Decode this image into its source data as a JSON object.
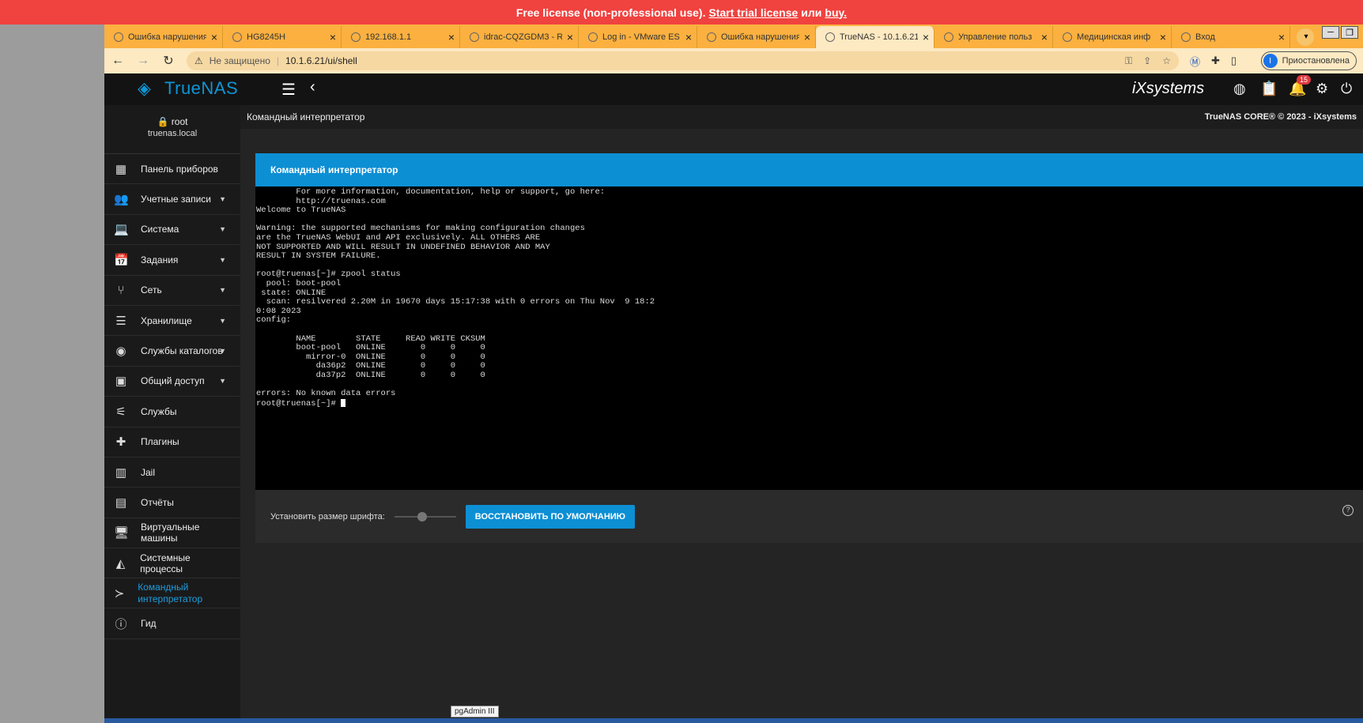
{
  "banner": {
    "text": "Free license (non-professional use).",
    "trial": "Start trial license",
    "or": "или",
    "buy": "buy."
  },
  "browser": {
    "tabs": [
      {
        "title": "Ошибка нарушения ко",
        "active": false
      },
      {
        "title": "HG8245H",
        "active": false
      },
      {
        "title": "192.168.1.1",
        "active": false
      },
      {
        "title": "idrac-CQZGDM3 - R",
        "active": false
      },
      {
        "title": "Log in - VMware ES",
        "active": false
      },
      {
        "title": "Ошибка нарушения ко",
        "active": false
      },
      {
        "title": "TrueNAS - 10.1.6.21",
        "active": true
      },
      {
        "title": "Управление польз",
        "active": false
      },
      {
        "title": "Медицинская инф",
        "active": false
      },
      {
        "title": "Вход",
        "active": false
      }
    ],
    "address": {
      "security": "Не защищено",
      "url": "10.1.6.21/ui/shell"
    },
    "profile": {
      "initial": "I",
      "status": "Приостановлена"
    }
  },
  "app": {
    "logo": "TrueNAS",
    "logo_sub": "CORE",
    "vendor": "iXsystems",
    "notifications_count": "15",
    "page_title": "Командный интерпретатор",
    "copyright": "TrueNAS CORE® © 2023 - iXsystems"
  },
  "user": {
    "name": "root",
    "host": "truenas.local"
  },
  "sidebar": {
    "items": [
      {
        "label": "Панель приборов",
        "icon": "dashboard-icon",
        "glyph": "▦",
        "arrow": false
      },
      {
        "label": "Учетные записи",
        "icon": "people-icon",
        "glyph": "👥",
        "arrow": true
      },
      {
        "label": "Система",
        "icon": "laptop-icon",
        "glyph": "💻",
        "arrow": true
      },
      {
        "label": "Задания",
        "icon": "calendar-icon",
        "glyph": "📅",
        "arrow": true
      },
      {
        "label": "Сеть",
        "icon": "network-icon",
        "glyph": "⑂",
        "arrow": true
      },
      {
        "label": "Хранилище",
        "icon": "storage-icon",
        "glyph": "☰",
        "arrow": true
      },
      {
        "label": "Службы каталогов",
        "icon": "directory-icon",
        "glyph": "◉",
        "arrow": true
      },
      {
        "label": "Общий доступ",
        "icon": "share-icon",
        "glyph": "▣",
        "arrow": true
      },
      {
        "label": "Службы",
        "icon": "tune-icon",
        "glyph": "⚟",
        "arrow": false
      },
      {
        "label": "Плагины",
        "icon": "puzzle-icon",
        "glyph": "✚",
        "arrow": false
      },
      {
        "label": "Jail",
        "icon": "jail-icon",
        "glyph": "▥",
        "arrow": false
      },
      {
        "label": "Отчёты",
        "icon": "chart-icon",
        "glyph": "▤",
        "arrow": false
      },
      {
        "label": "Виртуальные машины",
        "icon": "monitor-icon",
        "glyph": "🖥",
        "arrow": false
      },
      {
        "label": "Системные процессы",
        "icon": "process-icon",
        "glyph": "◭",
        "arrow": false
      },
      {
        "label": "Командный интерпретатор",
        "icon": "shell-icon",
        "glyph": "≻",
        "arrow": false,
        "active": true
      },
      {
        "label": "Гид",
        "icon": "info-icon",
        "glyph": "ⓘ",
        "arrow": false
      }
    ]
  },
  "shell": {
    "card_title": "Командный интерпретатор",
    "output": "        For more information, documentation, help or support, go here:\n        http://truenas.com\nWelcome to TrueNAS\n\nWarning: the supported mechanisms for making configuration changes\nare the TrueNAS WebUI and API exclusively. ALL OTHERS ARE\nNOT SUPPORTED AND WILL RESULT IN UNDEFINED BEHAVIOR AND MAY\nRESULT IN SYSTEM FAILURE.\n\nroot@truenas[~]# zpool status\n  pool: boot-pool\n state: ONLINE\n  scan: resilvered 2.20M in 19670 days 15:17:38 with 0 errors on Thu Nov  9 18:2\n0:08 2023\nconfig:\n\n        NAME        STATE     READ WRITE CKSUM\n        boot-pool   ONLINE       0     0     0\n          mirror-0  ONLINE       0     0     0\n            da36p2  ONLINE       0     0     0\n            da37p2  ONLINE       0     0     0\n\nerrors: No known data errors\n",
    "prompt": "root@truenas[~]# ",
    "font_size_label": "Установить размер шрифта:",
    "font_size_level": 0.45,
    "reset_label": "ВОССТАНОВИТЬ ПО УМОЛЧАНИЮ"
  },
  "tooltip": "pgAdmin III",
  "colors": {
    "accent": "#0d8fd4",
    "banner": "#f0423f",
    "tabbar": "#fbb040"
  }
}
